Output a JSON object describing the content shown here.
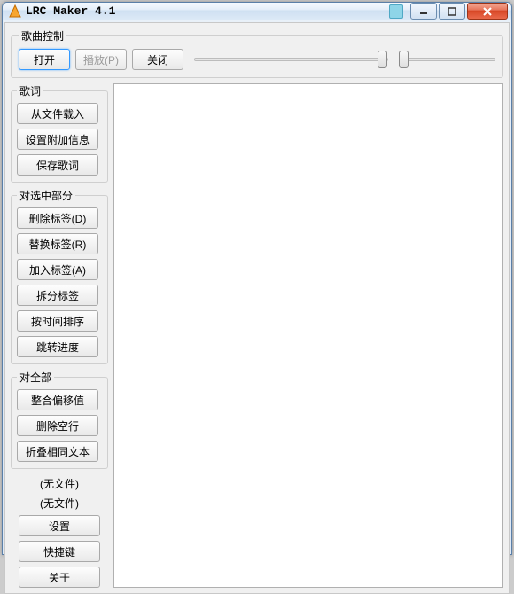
{
  "titlebar": {
    "title": "LRC Maker 4.1"
  },
  "song_control": {
    "legend": "歌曲控制",
    "open": "打开",
    "play": "播放(P)",
    "close": "关闭"
  },
  "lyrics": {
    "legend": "歌词",
    "load_from_file": "从文件载入",
    "set_extra_info": "设置附加信息",
    "save_lyrics": "保存歌词"
  },
  "selection": {
    "legend": "对选中部分",
    "delete_tag": "删除标签(D)",
    "replace_tag": "替换标签(R)",
    "add_tag": "加入标签(A)",
    "split_tag": "拆分标签",
    "sort_by_time": "按时间排序",
    "jump_progress": "跳转进度"
  },
  "overall": {
    "legend": "对全部",
    "merge_offset": "整合偏移值",
    "remove_blank": "删除空行",
    "fold_same_text": "折叠相同文本"
  },
  "extras": {
    "no_file_1": "(无文件)",
    "no_file_2": "(无文件)",
    "settings": "设置",
    "shortcuts": "快捷键",
    "about": "关于"
  }
}
